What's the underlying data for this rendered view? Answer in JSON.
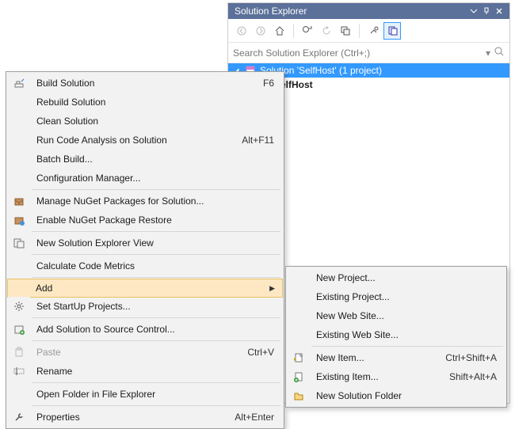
{
  "panel": {
    "title": "Solution Explorer",
    "search_placeholder": "Search Solution Explorer (Ctrl+;)"
  },
  "tree": {
    "root_label": "Solution 'SelfHost' (1 project)",
    "project_label": "SelfHost"
  },
  "ctx": {
    "build": "Build Solution",
    "build_sc": "F6",
    "rebuild": "Rebuild Solution",
    "clean": "Clean Solution",
    "analysis": "Run Code Analysis on Solution",
    "analysis_sc": "Alt+F11",
    "batch": "Batch Build...",
    "config": "Configuration Manager...",
    "nuget_manage": "Manage NuGet Packages for Solution...",
    "nuget_restore": "Enable NuGet Package Restore",
    "new_explorer": "New Solution Explorer View",
    "metrics": "Calculate Code Metrics",
    "add": "Add",
    "startup": "Set StartUp Projects...",
    "sourcectrl": "Add Solution to Source Control...",
    "paste": "Paste",
    "paste_sc": "Ctrl+V",
    "rename": "Rename",
    "open_folder": "Open Folder in File Explorer",
    "properties": "Properties",
    "properties_sc": "Alt+Enter"
  },
  "sub": {
    "new_project": "New Project...",
    "existing_project": "Existing Project...",
    "new_website": "New Web Site...",
    "existing_website": "Existing Web Site...",
    "new_item": "New Item...",
    "new_item_sc": "Ctrl+Shift+A",
    "existing_item": "Existing Item...",
    "existing_item_sc": "Shift+Alt+A",
    "new_folder": "New Solution Folder"
  }
}
